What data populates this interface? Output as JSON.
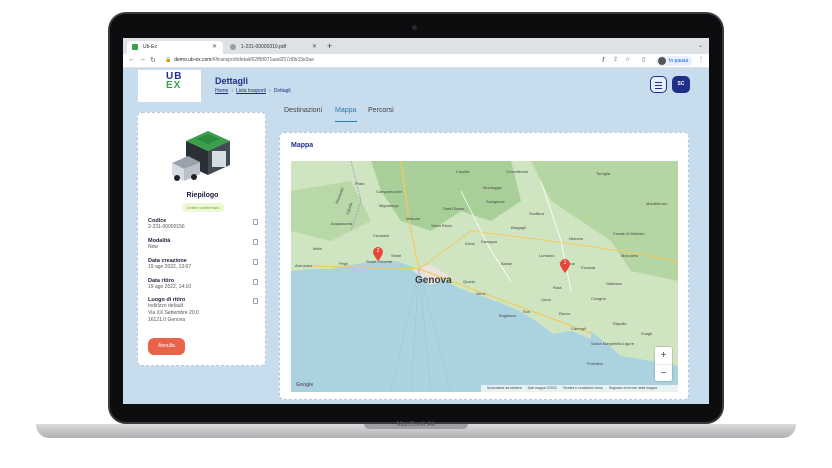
{
  "browser": {
    "tabs": [
      {
        "title": "Ub-Ex",
        "active": true
      },
      {
        "title": "1-231-00000310.pdf",
        "active": false
      }
    ],
    "new_tab": "+",
    "url_host": "demo.ub-ex.com",
    "url_path": "/#/transport/detail/62ff6f071aad257d0b33e3ae",
    "profile_status": "In pausa"
  },
  "app": {
    "logo_top": "UB",
    "logo_bottom": "EX",
    "page_title": "Dettagli",
    "breadcrumb": [
      "Home",
      "Lista trasporti",
      "Dettagli"
    ],
    "user_initials": "SC",
    "summary": {
      "title": "Riepilogo",
      "status": "Ordine confermato",
      "fields": [
        {
          "label": "Codice",
          "value": [
            "2-231-00000156"
          ]
        },
        {
          "label": "Modalità",
          "value": [
            "Now"
          ]
        },
        {
          "label": "Data creazione",
          "value": [
            "19 ago 2022, 13:07"
          ]
        },
        {
          "label": "Data ritiro",
          "value": [
            "19 ago 2022, 14:10"
          ]
        },
        {
          "label": "Luogo di ritiro",
          "value": [
            "Indirizzo default",
            "Via XX Settembre 20.0",
            "16121.0 Genova"
          ]
        }
      ],
      "cancel_label": "Annulla"
    },
    "tabs": [
      "Destinazioni",
      "Mappa",
      "Percorsi"
    ],
    "active_tab": "Mappa",
    "map": {
      "title": "Mappa",
      "city": "Genova",
      "towns": [
        "Prato",
        "Campomorone",
        "Masone",
        "Mele",
        "Casella",
        "Montoggio",
        "Torriglia",
        "Crocefieschi",
        "Savignone",
        "Scoffera",
        "Bargagli",
        "Davagna",
        "Lumarzo",
        "Neirone",
        "Ferrada",
        "Moconesi",
        "Gattorna",
        "Cicagna",
        "Favale di Malvaro",
        "Uscio",
        "Sori",
        "Recco",
        "Camogli",
        "Bogliasco",
        "Nervi",
        "Sant'Olcese",
        "Serra Riccò",
        "Mignanego",
        "Acquasanta",
        "Arenzano",
        "Pegli",
        "Sestri Ponente",
        "Ceranesi",
        "Doria",
        "Quarto",
        "Rapallo",
        "Zoagli",
        "Ruta",
        "Portofino",
        "Santa Margherita Ligure",
        "Tribogna",
        "Montebruno",
        "Bavari",
        "Piemonte",
        "Liguria",
        "Sestri"
      ],
      "markers": [
        "2",
        "1"
      ],
      "zoom_in": "+",
      "zoom_out": "−",
      "google": "Google",
      "attribution": [
        "Scorciatoie da tastiera",
        "Dati mappa ©2022",
        "Termini e condizioni d'uso",
        "Segnala un errore nella mappa"
      ]
    }
  },
  "device_label": "MacBook Air",
  "colors": {
    "primary": "#1f2f86",
    "accent_tab": "#2a7ab0",
    "cancel": "#e9624a",
    "app_bg": "#c7dcec"
  }
}
